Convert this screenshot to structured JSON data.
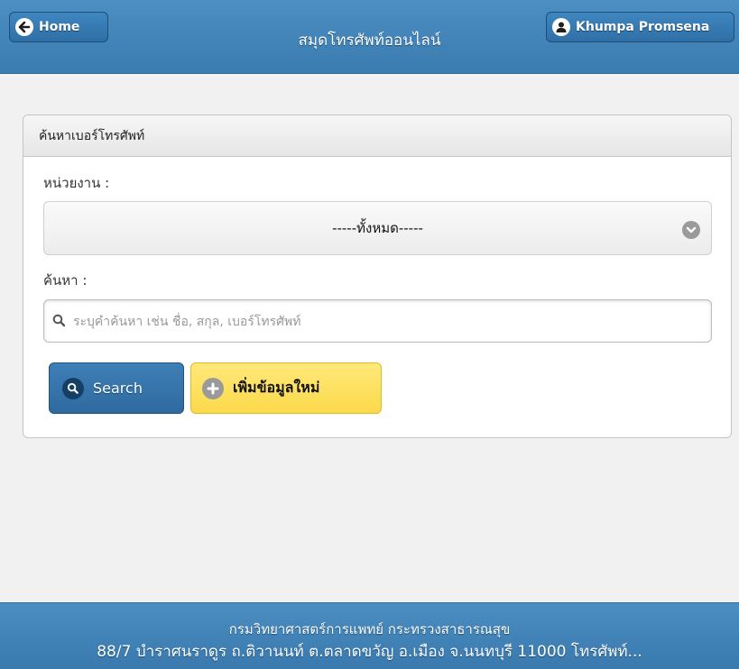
{
  "header": {
    "title": "สมุดโทรศัพท์ออนไลน์",
    "home_label": "Home",
    "user_label": "Khumpa Promsena"
  },
  "panel": {
    "heading": "ค้นหาเบอร์โทรศัพท์",
    "unit_label": "หน่วยงาน :",
    "unit_selected": "-----ทั้งหมด-----",
    "search_label": "ค้นหา :",
    "search_placeholder": "ระบุคำค้นหา เช่น ชื่อ, สกุล, เบอร์โทรศัพท์",
    "search_value": "",
    "search_button": "Search",
    "add_button": "เพิ่มข้อมูลใหม่"
  },
  "footer": {
    "line1": "กรมวิทยาศาสตร์การแพทย์ กระทรวงสาธารณสุข",
    "line2": "88/7 บำราศนราดูร ถ.ติวานนท์ ต.ตลาดขวัญ อ.เมือง จ.นนทบุรี 11000 โทรศัพท์..."
  },
  "icons": {
    "home": "arrow-left-icon",
    "user": "user-icon",
    "select": "chevron-down-icon",
    "search": "search-icon",
    "add": "plus-icon"
  },
  "colors": {
    "header_bg": "#3f82b8",
    "search_button_bg": "#3574ab",
    "add_button_bg": "#fbdf5c"
  }
}
